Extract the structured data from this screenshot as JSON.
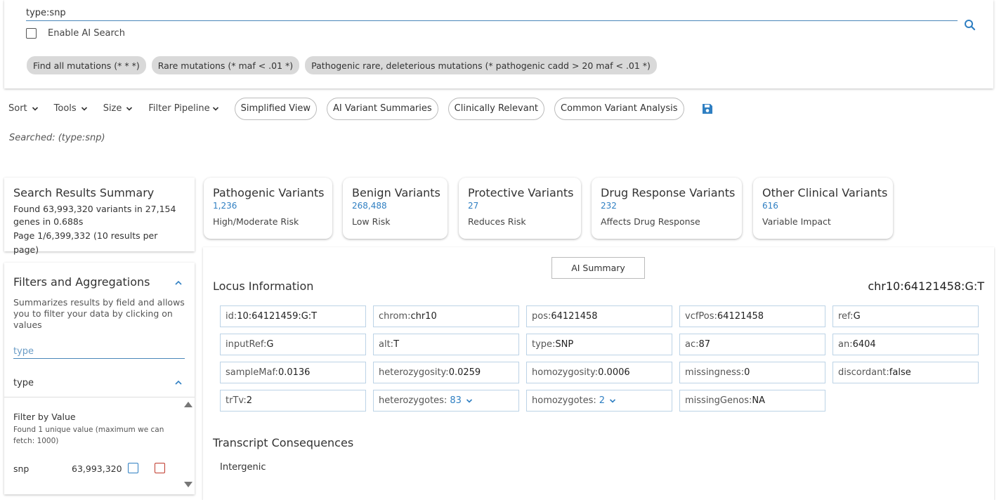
{
  "search": {
    "value": "type:snp"
  },
  "ai_search": {
    "label": "Enable AI Search",
    "checked": false
  },
  "chips": [
    "Find all mutations (* * *)",
    "Rare mutations (* maf < .01 *)",
    "Pathogenic rare, deleterious mutations (* pathogenic cadd > 20 maf < .01 *)"
  ],
  "toolbar": {
    "menus": [
      "Sort",
      "Tools",
      "Size",
      "Filter Pipeline"
    ],
    "pills": [
      "Simplified View",
      "AI Variant Summaries",
      "Clinically Relevant",
      "Common Variant Analysis"
    ]
  },
  "searched": {
    "label": "Searched:",
    "query": "(type:snp)"
  },
  "summary": {
    "title": "Search Results Summary",
    "line1_a": "Found ",
    "variants": "63,993,320",
    "line1_b": " variants in ",
    "genes": "27,154",
    "line2": "genes in 0.688s",
    "page": "Page 1/6,399,332 (10 results per page)"
  },
  "variant_cards": [
    {
      "title": "Pathogenic Variants",
      "count": "1,236",
      "desc": "High/Moderate Risk"
    },
    {
      "title": "Benign Variants",
      "count": "268,488",
      "desc": "Low Risk"
    },
    {
      "title": "Protective Variants",
      "count": "27",
      "desc": "Reduces Risk"
    },
    {
      "title": "Drug Response Variants",
      "count": "232",
      "desc": "Affects Drug Response"
    },
    {
      "title": "Other Clinical Variants",
      "count": "616",
      "desc": "Variable Impact"
    }
  ],
  "filters": {
    "title": "Filters and Aggregations",
    "description": "Summarizes results by field and allows you to filter your data by clicking on values",
    "input_placeholder": "type",
    "field_name": "type",
    "filter_by_value": "Filter by Value",
    "found_unique": "Found 1 unique value (maximum we can fetch: 1000)",
    "values": [
      {
        "name": "snp",
        "count": "63,993,320"
      }
    ]
  },
  "locus": {
    "ai_summary_label": "AI Summary",
    "title": "Locus Information",
    "id": "chr10:64121458:G:T",
    "fields": [
      {
        "k": "id:",
        "v": "10:64121459:G:T"
      },
      {
        "k": "chrom:",
        "v": "chr10"
      },
      {
        "k": "pos:",
        "v": "64121458"
      },
      {
        "k": "vcfPos:",
        "v": "64121458"
      },
      {
        "k": "ref:",
        "v": "G"
      },
      {
        "k": "inputRef:",
        "v": "G"
      },
      {
        "k": "alt:",
        "v": "T"
      },
      {
        "k": "type:",
        "v": "SNP"
      },
      {
        "k": "ac:",
        "v": "87"
      },
      {
        "k": "an:",
        "v": "6404"
      },
      {
        "k": "sampleMaf:",
        "v": "0.0136"
      },
      {
        "k": "heterozygosity:",
        "v": "0.0259"
      },
      {
        "k": "homozygosity:",
        "v": "0.0006"
      },
      {
        "k": "missingness:",
        "v": "0"
      },
      {
        "k": "discordant:",
        "v": "false"
      },
      {
        "k": "trTv:",
        "v": "2"
      },
      {
        "k": "heterozygotes:",
        "v": "83",
        "link": true
      },
      {
        "k": "homozygotes:",
        "v": "2",
        "link": true
      },
      {
        "k": "missingGenos:",
        "v": "NA"
      }
    ]
  },
  "transcript": {
    "title": "Transcript Consequences",
    "value": "Intergenic"
  },
  "colors": {
    "accent": "#2f7fc2",
    "chip_bg": "#d9d9d9",
    "danger": "#c0392b"
  }
}
